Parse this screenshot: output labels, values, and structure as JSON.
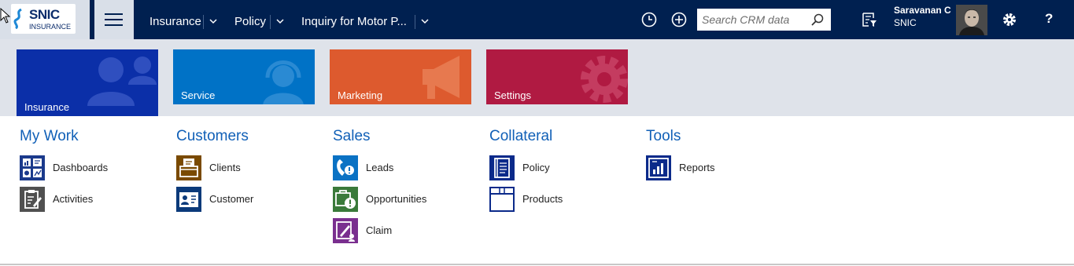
{
  "logo": {
    "line1": "SNIC",
    "line2": "INSURANCE"
  },
  "breadcrumb": [
    {
      "label": "Insurance"
    },
    {
      "label": "Policy"
    },
    {
      "label": "Inquiry for Motor P..."
    }
  ],
  "search": {
    "placeholder": "Search CRM data"
  },
  "user": {
    "name": "Saravanan C",
    "org": "SNIC"
  },
  "help_label": "?",
  "tiles": [
    {
      "label": "Insurance",
      "color": "#0b2fa8",
      "icon": "people-icon"
    },
    {
      "label": "Service",
      "color": "#0072c6",
      "icon": "headset-icon"
    },
    {
      "label": "Marketing",
      "color": "#dd5a2e",
      "icon": "megaphone-icon"
    },
    {
      "label": "Settings",
      "color": "#b01a42",
      "icon": "gear-icon"
    }
  ],
  "groups": [
    {
      "title": "My Work",
      "items": [
        {
          "label": "Dashboards",
          "icon": "dashboard-icon"
        },
        {
          "label": "Activities",
          "icon": "clipboard-icon"
        }
      ]
    },
    {
      "title": "Customers",
      "items": [
        {
          "label": "Clients",
          "icon": "folder-icon"
        },
        {
          "label": "Customer",
          "icon": "contact-card-icon"
        }
      ]
    },
    {
      "title": "Sales",
      "items": [
        {
          "label": "Leads",
          "icon": "phone-icon"
        },
        {
          "label": "Opportunities",
          "icon": "opportunity-icon"
        },
        {
          "label": "Claim",
          "icon": "claim-icon"
        }
      ]
    },
    {
      "title": "Collateral",
      "items": [
        {
          "label": "Policy",
          "icon": "policy-book-icon"
        },
        {
          "label": "Products",
          "icon": "box-icon"
        }
      ]
    },
    {
      "title": "Tools",
      "items": [
        {
          "label": "Reports",
          "icon": "report-icon"
        }
      ]
    }
  ],
  "colors": {
    "nav": "#002050",
    "accent": "#1160b7",
    "band": "#dfe3ea"
  }
}
